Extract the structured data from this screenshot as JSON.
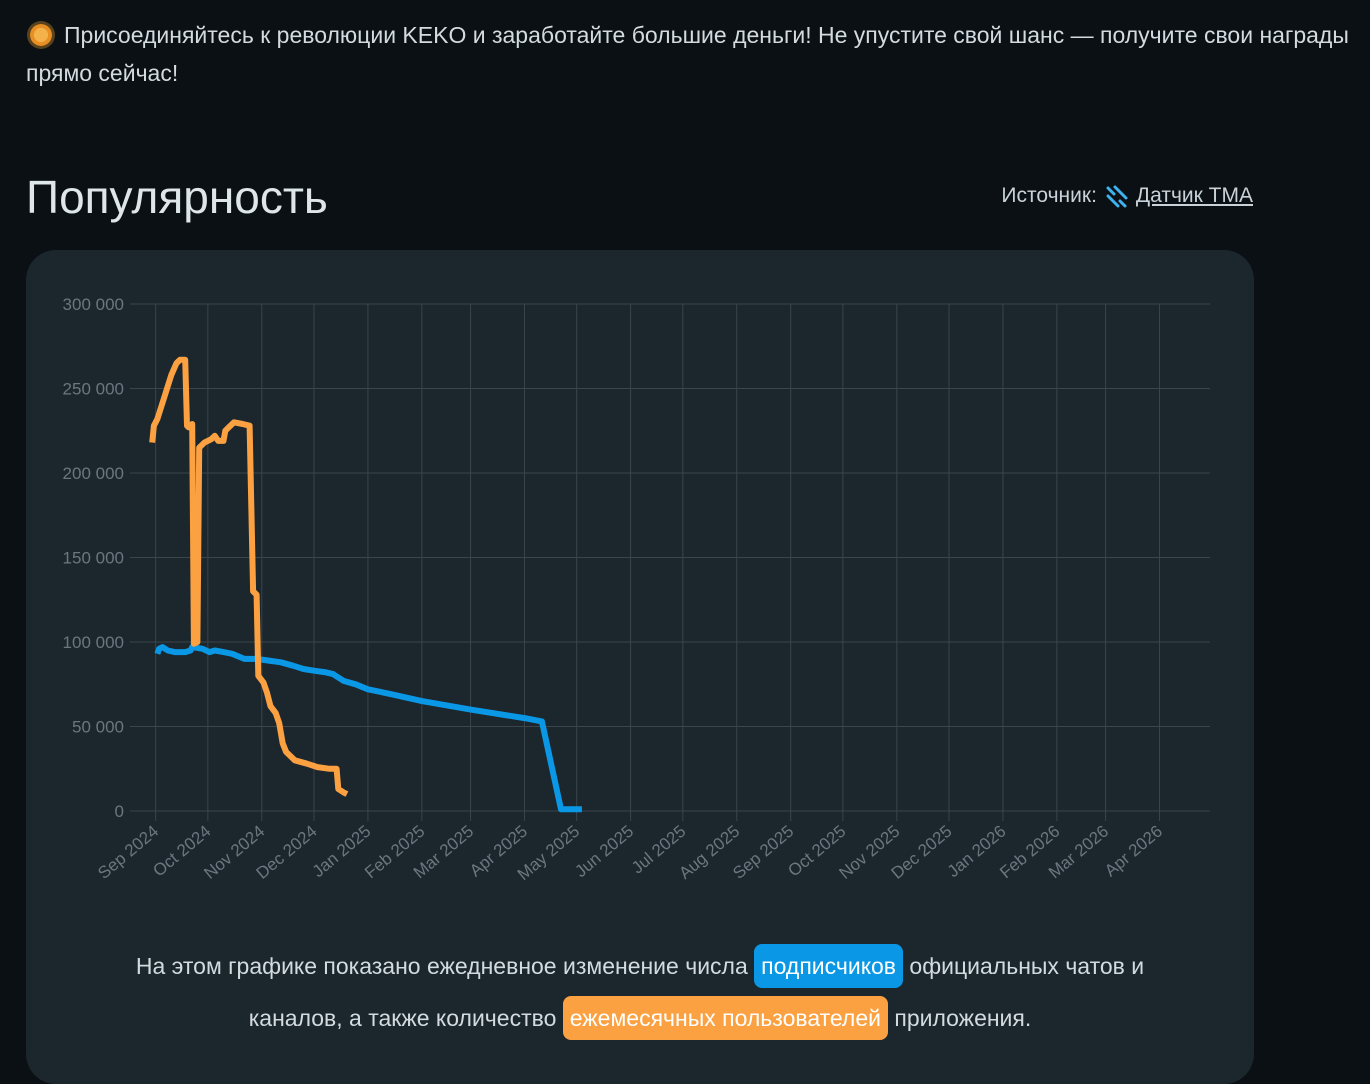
{
  "promo": {
    "icon": "sun-icon",
    "text": "Присоединяйтесь к революции KEKO и заработайте большие деньги! Не упустите свой шанс — получите свои награды прямо сейчас!"
  },
  "popularity": {
    "title": "Популярность",
    "source_label": "Источник:",
    "source_icon": "tma-sensor-icon",
    "source_link": "Датчик TMA",
    "caption": {
      "part1": "На этом графике показано ежедневное изменение числа",
      "highlight1": "подписчиков",
      "part2": "официальных чатов и каналов, а также количество",
      "highlight2": "ежемесячных пользователей",
      "part3": "приложения."
    }
  },
  "colors": {
    "subscribers": "#0a98e6",
    "monthly_users": "#fba141",
    "background": "#0a1014",
    "card": "#1b262d",
    "grid": "#3a454c",
    "tick": "#6b777e"
  },
  "chart_data": {
    "type": "line",
    "x_axis": "time",
    "x_ticks": [
      "Sep 2024",
      "Oct 2024",
      "Nov 2024",
      "Dec 2024",
      "Jan 2025",
      "Feb 2025",
      "Mar 2025",
      "Apr 2025",
      "May 2025",
      "Jun 2025",
      "Jul 2025",
      "Aug 2025",
      "Sep 2025",
      "Oct 2025",
      "Nov 2025",
      "Dec 2025",
      "Jan 2026",
      "Feb 2026",
      "Mar 2026",
      "Apr 2026"
    ],
    "y_ticks": [
      "300 000",
      "250 000",
      "200 000",
      "150 000",
      "100 000",
      "50 000",
      "0"
    ],
    "ylim": [
      0,
      300000
    ],
    "xlim": [
      "2024-08-23",
      "2026-04-30"
    ],
    "grid": true,
    "legend": "none",
    "series": [
      {
        "color": "#0a98e6",
        "points": [
          [
            "2024-09-02",
            93000
          ],
          [
            "2024-09-03",
            96000
          ],
          [
            "2024-09-05",
            97000
          ],
          [
            "2024-09-08",
            95000
          ],
          [
            "2024-09-12",
            94000
          ],
          [
            "2024-09-18",
            94000
          ],
          [
            "2024-09-21",
            95000
          ],
          [
            "2024-09-22",
            97000
          ],
          [
            "2024-09-28",
            96000
          ],
          [
            "2024-10-02",
            94000
          ],
          [
            "2024-10-05",
            95000
          ],
          [
            "2024-10-10",
            94000
          ],
          [
            "2024-10-15",
            93000
          ],
          [
            "2024-10-22",
            90000
          ],
          [
            "2024-10-29",
            90000
          ],
          [
            "2024-11-05",
            89000
          ],
          [
            "2024-11-12",
            88000
          ],
          [
            "2024-11-19",
            86000
          ],
          [
            "2024-11-25",
            84000
          ],
          [
            "2024-12-01",
            83000
          ],
          [
            "2024-12-08",
            82000
          ],
          [
            "2024-12-12",
            81000
          ],
          [
            "2024-12-18",
            77000
          ],
          [
            "2024-12-25",
            75000
          ],
          [
            "2025-01-01",
            72000
          ],
          [
            "2025-01-15",
            69000
          ],
          [
            "2025-02-01",
            65000
          ],
          [
            "2025-03-01",
            60000
          ],
          [
            "2025-04-01",
            55000
          ],
          [
            "2025-04-11",
            53000
          ],
          [
            "2025-04-22",
            1000
          ],
          [
            "2025-05-04",
            1000
          ]
        ]
      },
      {
        "color": "#fba141",
        "points": [
          [
            "2024-08-30",
            218000
          ],
          [
            "2024-08-31",
            228000
          ],
          [
            "2024-09-02",
            232000
          ],
          [
            "2024-09-06",
            245000
          ],
          [
            "2024-09-10",
            258000
          ],
          [
            "2024-09-13",
            265000
          ],
          [
            "2024-09-15",
            267000
          ],
          [
            "2024-09-18",
            267000
          ],
          [
            "2024-09-19",
            228000
          ],
          [
            "2024-09-20",
            227000
          ],
          [
            "2024-09-22",
            229000
          ],
          [
            "2024-09-23",
            99000
          ],
          [
            "2024-09-25",
            100000
          ],
          [
            "2024-09-26",
            215000
          ],
          [
            "2024-09-29",
            218000
          ],
          [
            "2024-10-03",
            220000
          ],
          [
            "2024-10-05",
            222000
          ],
          [
            "2024-10-07",
            219000
          ],
          [
            "2024-10-10",
            219000
          ],
          [
            "2024-10-11",
            225000
          ],
          [
            "2024-10-13",
            227000
          ],
          [
            "2024-10-16",
            230000
          ],
          [
            "2024-10-21",
            229000
          ],
          [
            "2024-10-25",
            228000
          ],
          [
            "2024-10-27",
            130000
          ],
          [
            "2024-10-29",
            128000
          ],
          [
            "2024-10-30",
            80000
          ],
          [
            "2024-11-02",
            76000
          ],
          [
            "2024-11-04",
            70000
          ],
          [
            "2024-11-06",
            62000
          ],
          [
            "2024-11-09",
            58000
          ],
          [
            "2024-11-11",
            52000
          ],
          [
            "2024-11-13",
            40000
          ],
          [
            "2024-11-15",
            35000
          ],
          [
            "2024-11-20",
            30000
          ],
          [
            "2024-11-27",
            28000
          ],
          [
            "2024-12-03",
            26000
          ],
          [
            "2024-12-10",
            25000
          ],
          [
            "2024-12-14",
            25000
          ],
          [
            "2024-12-15",
            13000
          ],
          [
            "2024-12-18",
            11000
          ],
          [
            "2024-12-20",
            10000
          ]
        ]
      }
    ]
  }
}
